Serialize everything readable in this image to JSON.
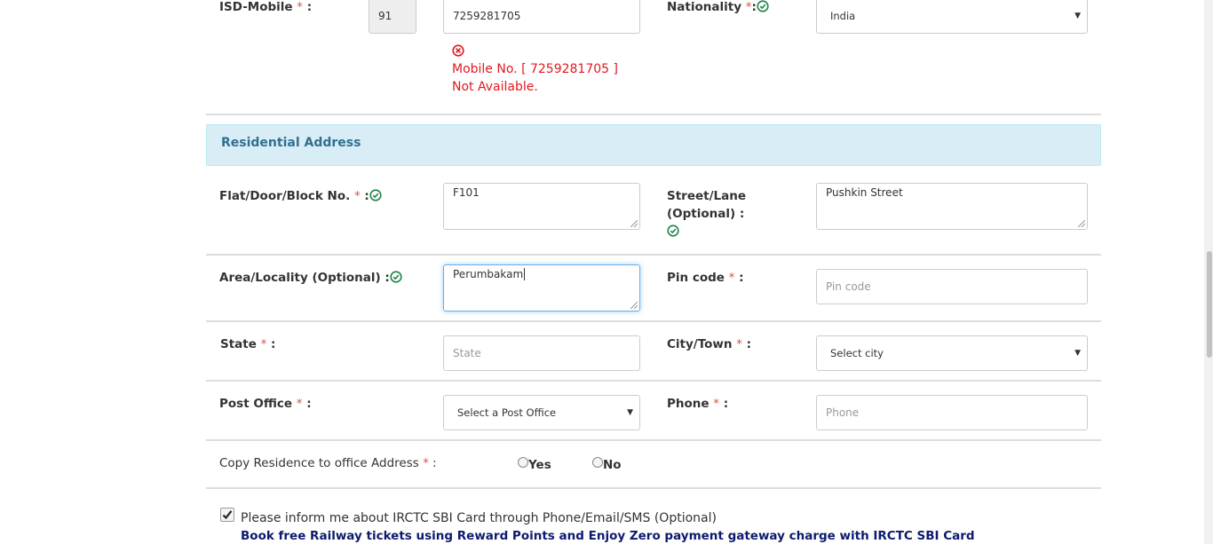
{
  "contact": {
    "isd_label": "ISD-Mobile",
    "req": "*",
    "label_sep": " :",
    "isd_code": "91",
    "mobile_value": "7259281705",
    "mobile_error": "Mobile No. [ 7259281705 ] Not Available.",
    "nationality_label": "Nationality",
    "nationality_value": "India"
  },
  "section": {
    "title": "Residential Address"
  },
  "address": {
    "flat_label": "Flat/Door/Block No.",
    "flat_value": "F101",
    "street_label_line1": "Street/Lane",
    "street_label_line2": "(Optional) :",
    "street_value": "Pushkin Street",
    "area_label": "Area/Locality (Optional)",
    "area_value": "Perumbakam",
    "pincode_label": "Pin code",
    "pincode_placeholder": "Pin code",
    "state_label": "State",
    "state_placeholder": "State",
    "city_label": "City/Town",
    "city_value": "Select city",
    "postoffice_label": "Post Office",
    "postoffice_value": "Select a Post Office",
    "phone_label": "Phone",
    "phone_placeholder": "Phone"
  },
  "copy": {
    "label": "Copy Residence to office Address",
    "yes": "Yes",
    "no": "No"
  },
  "sbi": {
    "checked": true,
    "text": "Please inform me about IRCTC SBI Card through Phone/Email/SMS (Optional)",
    "promo": "Book free Railway tickets using Reward Points and Enjoy Zero payment gateway charge with IRCTC SBI Card"
  },
  "colors": {
    "section_bg": "#d9edf7",
    "section_text": "#31708f",
    "error": "#e0191f",
    "ok": "#1e8449",
    "promo": "#0d1a6e"
  },
  "icons": {
    "valid": "check-circle-icon",
    "error": "x-circle-icon",
    "dropdown": "caret-down-icon"
  }
}
